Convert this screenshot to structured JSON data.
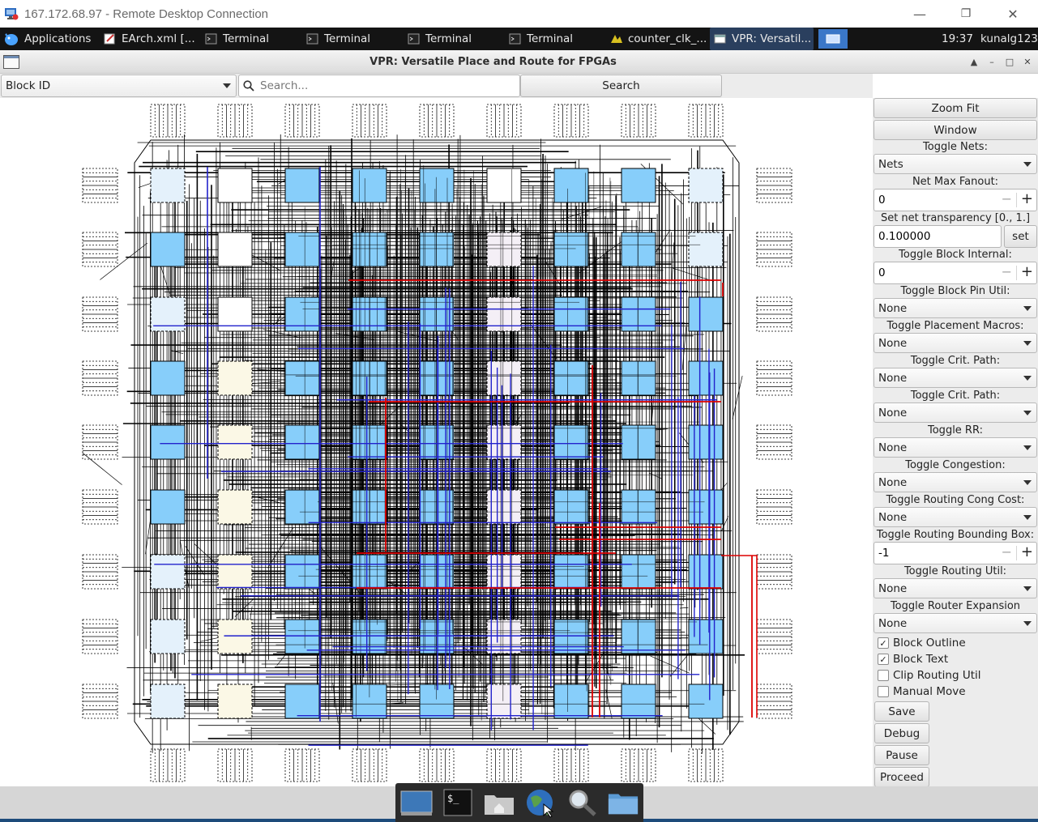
{
  "rdp": {
    "title": "167.172.68.97 - Remote Desktop Connection",
    "minimize": "—",
    "maximize": "❐",
    "close": "✕"
  },
  "panel": {
    "applications": "Applications",
    "tasks": [
      {
        "label": "EArch.xml [...",
        "icon": "text-editor-icon"
      },
      {
        "label": "Terminal",
        "icon": "terminal-icon"
      },
      {
        "label": "Terminal",
        "icon": "terminal-icon"
      },
      {
        "label": "Terminal",
        "icon": "terminal-icon"
      },
      {
        "label": "Terminal",
        "icon": "terminal-icon"
      },
      {
        "label": "counter_clk_...",
        "icon": "gtkwave-icon"
      },
      {
        "label": "VPR: Versatil...",
        "icon": "window-icon"
      }
    ],
    "clock": "19:37",
    "user": "kunalg123"
  },
  "window": {
    "title": "VPR: Versatile Place and Route for FPGAs"
  },
  "search": {
    "mode": "Block ID",
    "placeholder": "Search...",
    "button": "Search"
  },
  "controls": {
    "zoom_fit": "Zoom Fit",
    "window": "Window",
    "toggle_nets_label": "Toggle Nets:",
    "toggle_nets_value": "Nets",
    "net_max_fanout_label": "Net Max Fanout:",
    "net_max_fanout_value": "0",
    "net_transparency_label": "Set net transparency [0., 1.]",
    "net_transparency_value": "0.100000",
    "set_button": "set",
    "block_internal_label": "Toggle Block Internal:",
    "block_internal_value": "0",
    "block_pin_util_label": "Toggle Block Pin Util:",
    "block_pin_util_value": "None",
    "placement_macros_label": "Toggle Placement Macros:",
    "placement_macros_value": "None",
    "crit_path_label_1": "Toggle Crit. Path:",
    "crit_path_value_1": "None",
    "crit_path_label_2": "Toggle Crit. Path:",
    "crit_path_value_2": "None",
    "rr_label": "Toggle RR:",
    "rr_value": "None",
    "congestion_label": "Toggle Congestion:",
    "congestion_value": "None",
    "routing_cong_cost_label": "Toggle Routing Cong Cost:",
    "routing_cong_cost_value": "None",
    "routing_bbox_label": "Toggle Routing Bounding Box:",
    "routing_bbox_value": "-1",
    "routing_util_label": "Toggle Routing Util:",
    "routing_util_value": "None",
    "router_expansion_label": "Toggle Router Expansion Costs:",
    "router_expansion_value": "None",
    "block_outline": "Block Outline",
    "block_outline_checked": true,
    "block_text": "Block Text",
    "block_text_checked": true,
    "clip_routing_util": "Clip Routing Util",
    "clip_routing_util_checked": false,
    "manual_move": "Manual Move",
    "manual_move_checked": false,
    "save": "Save",
    "debug": "Debug",
    "pause": "Pause",
    "proceed": "Proceed",
    "minus": "−",
    "plus": "+"
  },
  "colors": {
    "clb_fill": "#87cefa",
    "empty_clb": "#e4f1fb",
    "memory_fill": "#fbf8e6",
    "mult_fill": "#f4eff6",
    "net_black": "#000000",
    "net_blue": "#2222cc",
    "net_red": "#dd0000"
  }
}
